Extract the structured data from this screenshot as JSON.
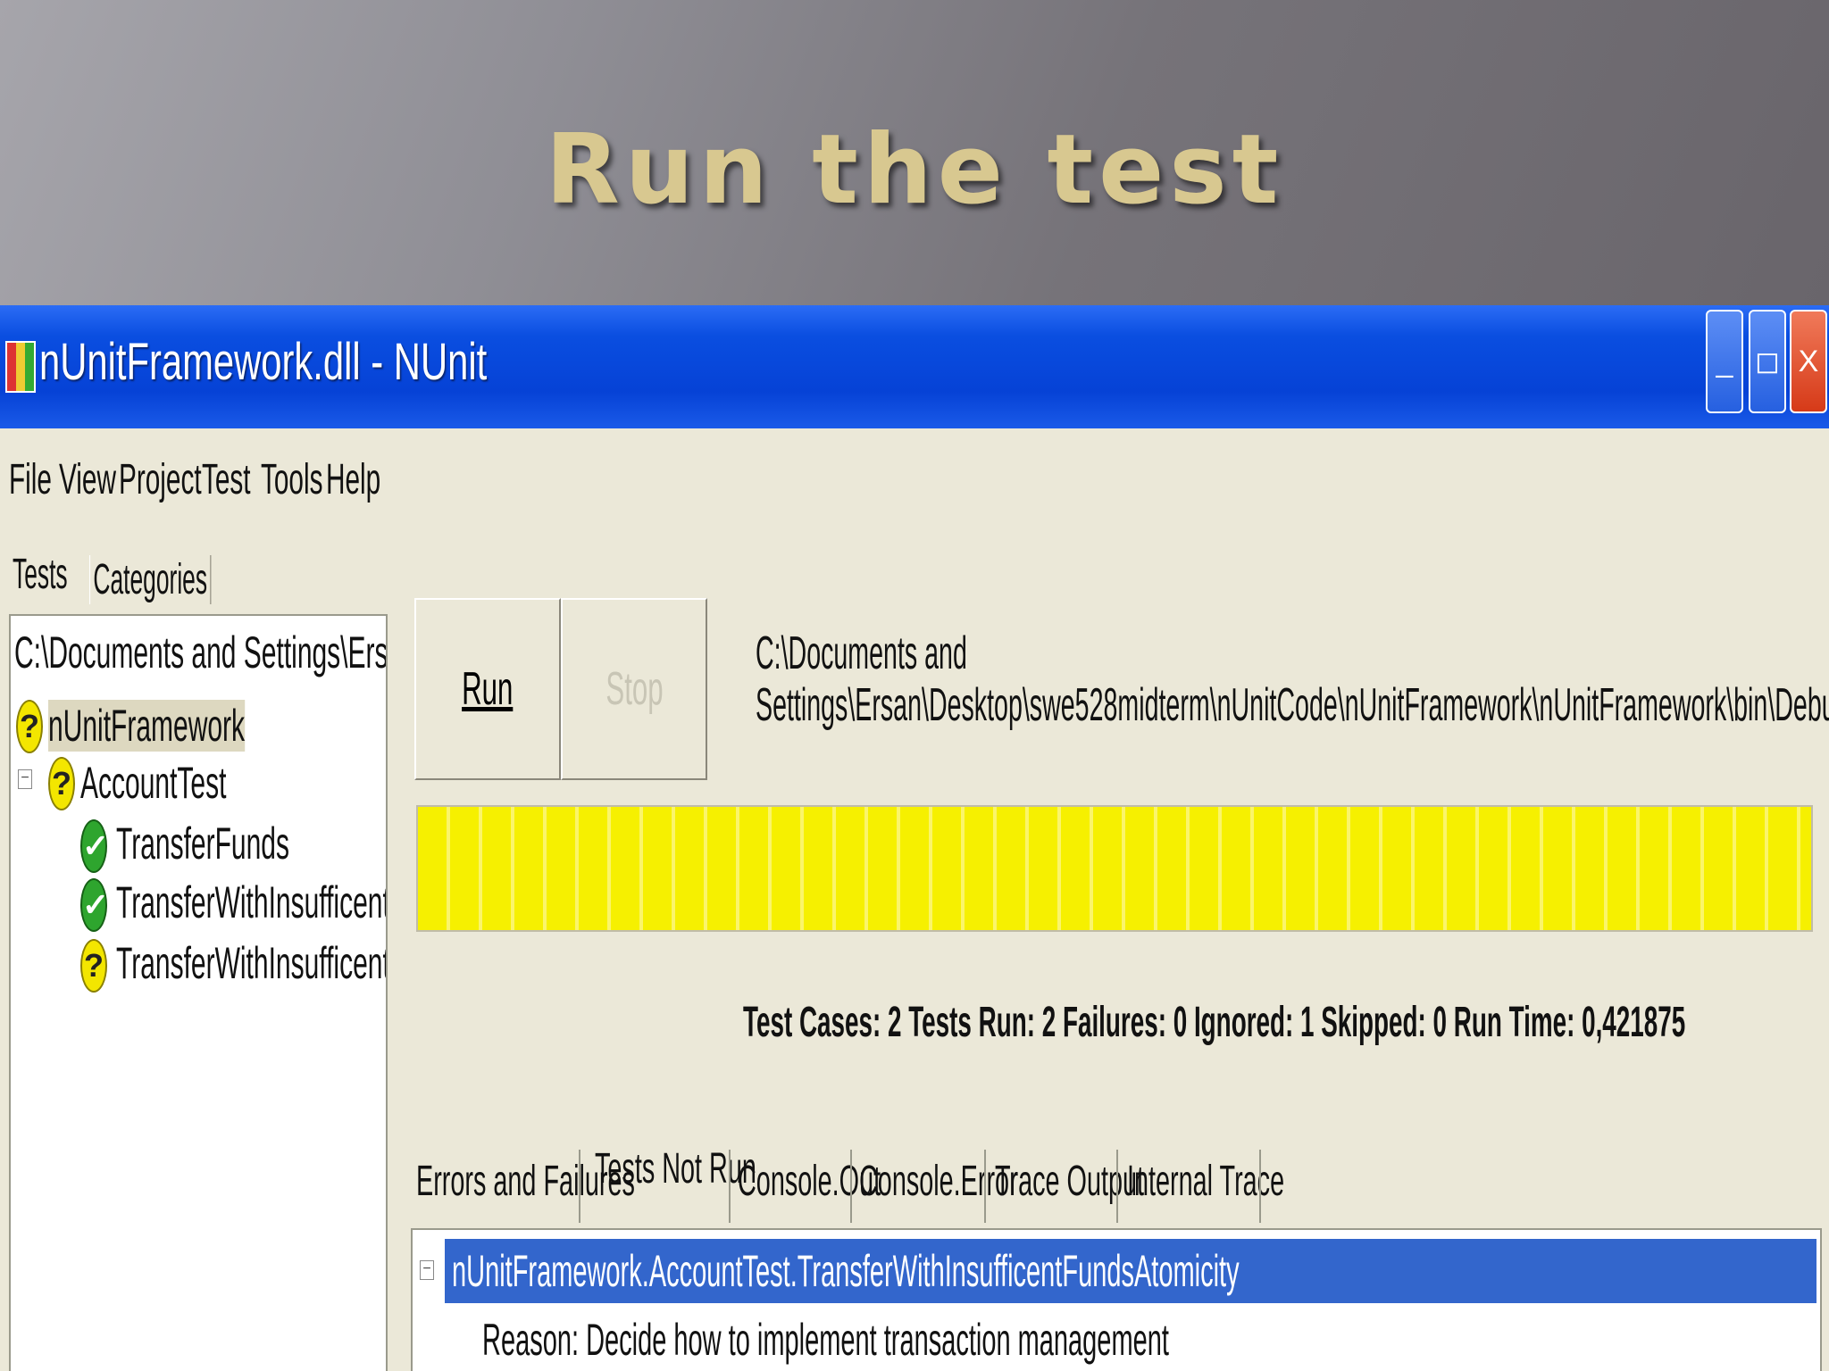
{
  "slide": {
    "title": "Run the test"
  },
  "window": {
    "title": "nUnitFramework.dll - NUnit",
    "buttons": {
      "minimize": "_",
      "maximize": "◻",
      "close": "X"
    }
  },
  "menu": [
    "File",
    "View",
    "Project",
    "Test",
    "Tools",
    "Help"
  ],
  "left_tabs": [
    "Tests",
    "Categories"
  ],
  "tree": {
    "root_path": "C:\\Documents and Settings\\Ersan\\Desktop",
    "project": "nUnitFramework",
    "fixture": "AccountTest",
    "tests": [
      {
        "name": "TransferFunds",
        "status": "passed"
      },
      {
        "name": "TransferWithInsufficentFunds",
        "status": "passed"
      },
      {
        "name": "TransferWithInsufficentFundsAtomicity",
        "status": "ignored"
      }
    ]
  },
  "actions": {
    "run": "Run",
    "stop": "Stop"
  },
  "assembly_path": {
    "line1": "C:\\Documents and",
    "line2": "Settings\\Ersan\\Desktop\\swe528midterm\\nUnitCode\\nUnitFramework\\nUnitFramework\\bin\\Debug\\nUnitFramework.dll"
  },
  "progress": {
    "fraction": 1.0,
    "color": "#f6f000"
  },
  "stats": {
    "text": "Test Cases: 2   Tests Run: 2   Failures: 0   Ignored: 1   Skipped: 0   Run Time: 0,421875"
  },
  "result_tabs": [
    "Errors and Failures",
    "Tests Not Run",
    "Console.Out",
    "Console.Error",
    "Trace Output",
    "Internal Trace"
  ],
  "tests_not_run": {
    "item": "nUnitFramework.AccountTest.TransferWithInsufficentFundsAtomicity",
    "reason": "Reason: Decide how to implement transaction management"
  }
}
